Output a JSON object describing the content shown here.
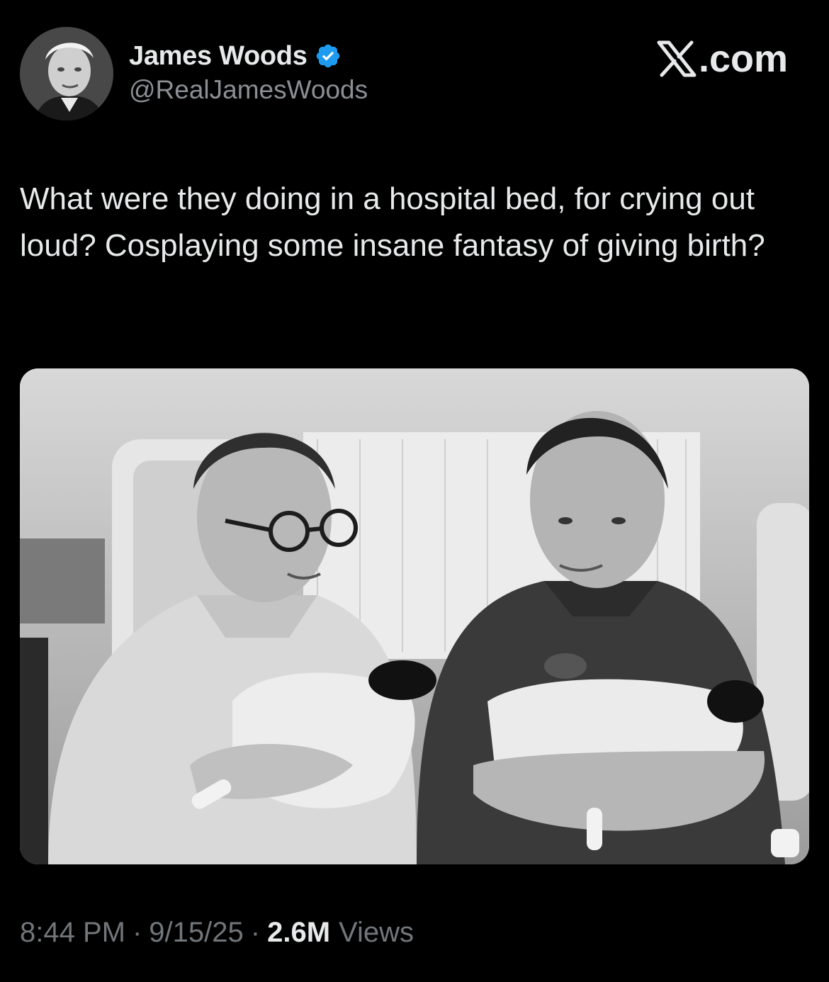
{
  "tweet": {
    "author": {
      "display_name": "James Woods",
      "handle": "@RealJamesWoods",
      "verified": true,
      "avatar_icon": "avatar-photo"
    },
    "site_label": "X.com",
    "text": "What were they doing in a hospital bed, for crying out loud? Cosplaying some insane fantasy of giving birth?",
    "media": {
      "type": "photo",
      "icon": "photo"
    },
    "meta": {
      "time": "8:44 PM",
      "separator": "·",
      "date": "9/15/25",
      "views_count": "2.6M",
      "views_label": "Views"
    }
  },
  "colors": {
    "background": "#000000",
    "primary_text": "#e7e9ea",
    "secondary_text": "#71767b",
    "verified_badge": "#1d9bf0"
  }
}
